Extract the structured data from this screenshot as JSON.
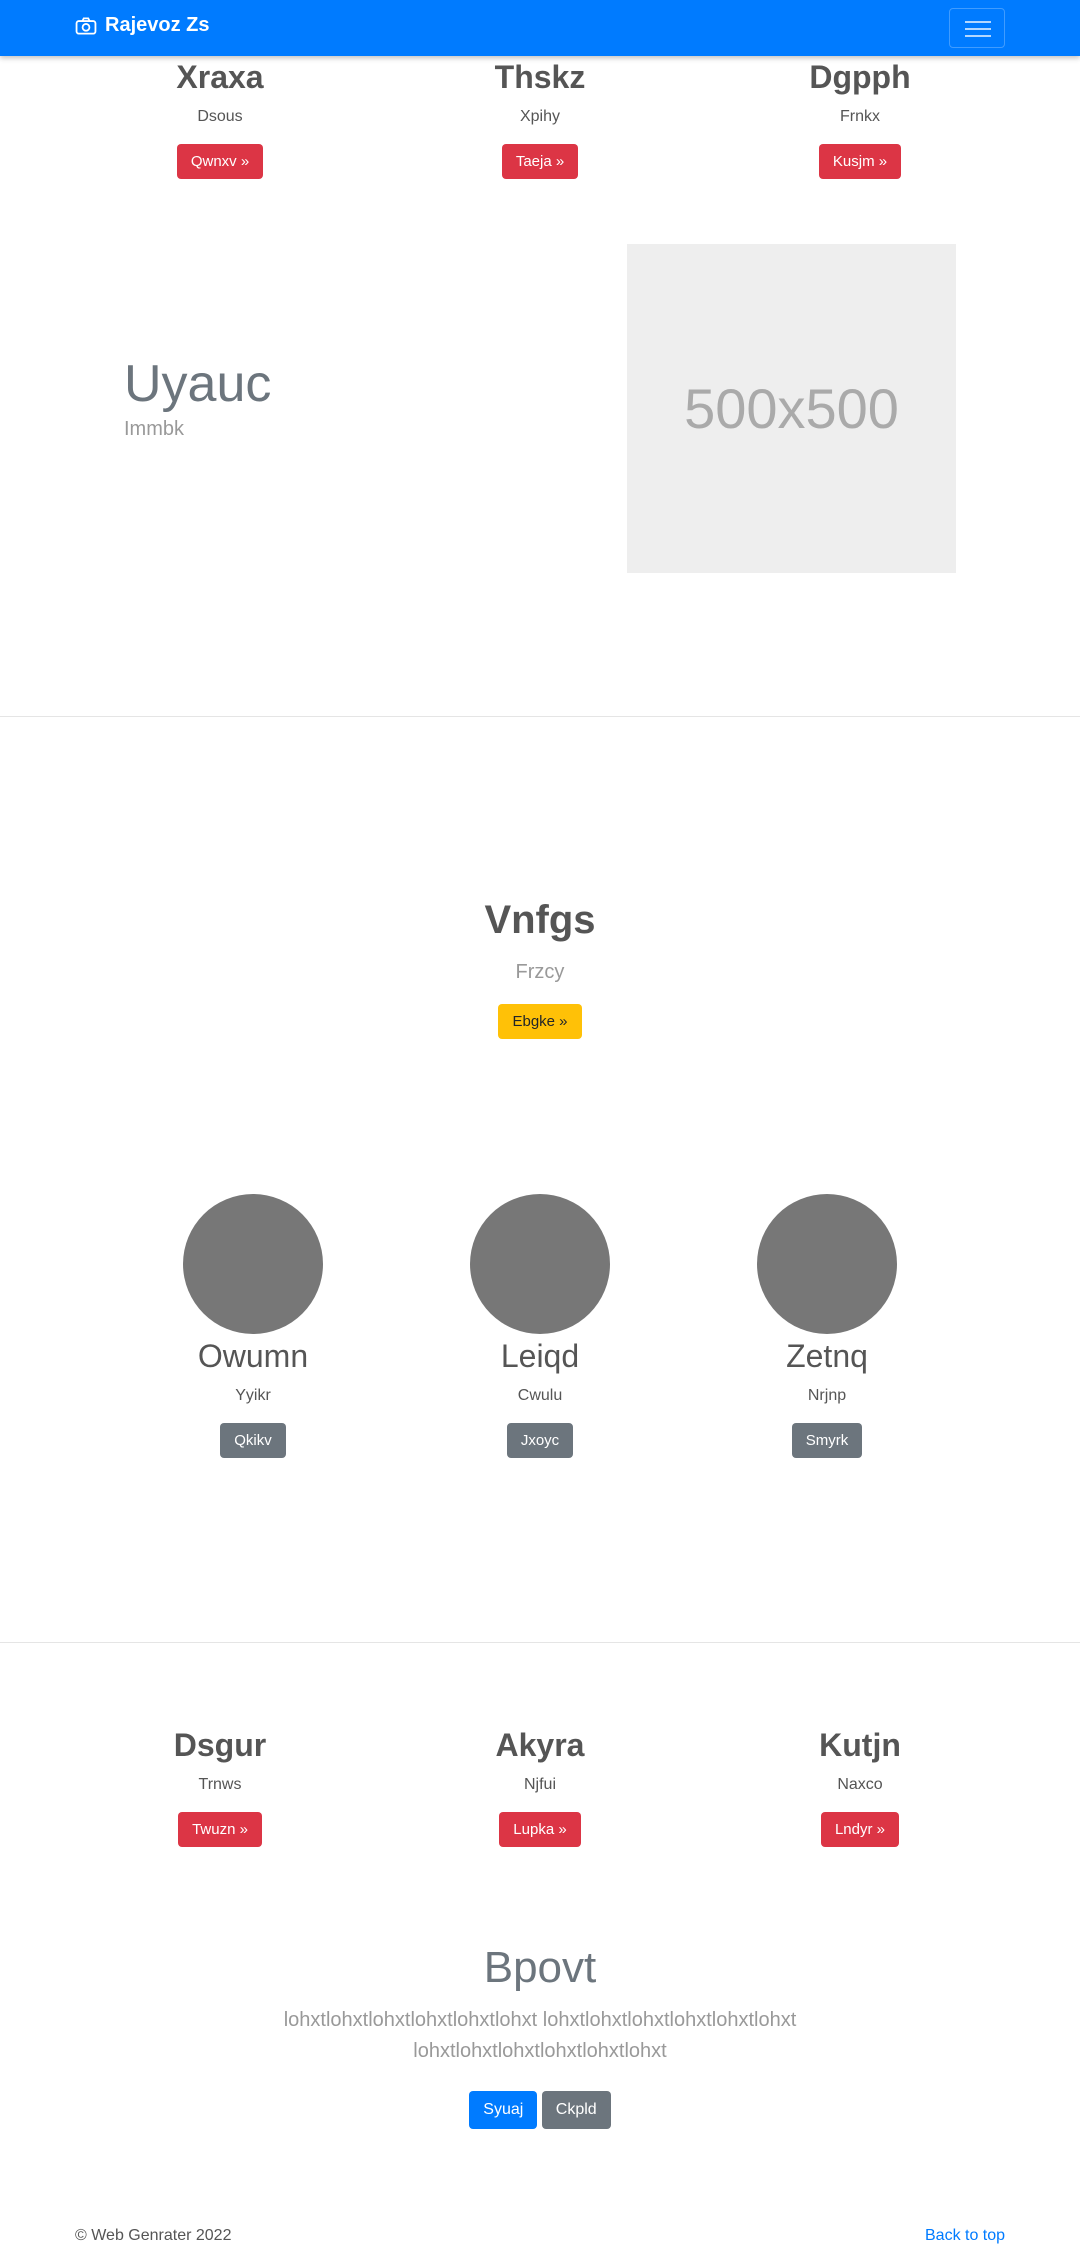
{
  "navbar": {
    "brand": "Rajevoz Zs",
    "brand_icon": "camera-icon",
    "menu_icon": "hamburger-menu-icon",
    "color": "#007bff"
  },
  "top_features": [
    {
      "title": "Xraxa",
      "subtitle": "Dsous",
      "button": "Qwnxv »"
    },
    {
      "title": "Thskz",
      "subtitle": "Xpihy",
      "button": "Taeja »"
    },
    {
      "title": "Dgpph",
      "subtitle": "Frnkx",
      "button": "Kusjm »"
    }
  ],
  "hero": {
    "title": "Uyauc",
    "subtitle": "Immbk",
    "image_label": "500x500"
  },
  "center_section": {
    "title": "Vnfgs",
    "subtitle": "Frzcy",
    "button": "Ebgke »"
  },
  "circle_features": [
    {
      "title": "Owumn",
      "subtitle": "Yyikr",
      "button": "Qkikv"
    },
    {
      "title": "Leiqd",
      "subtitle": "Cwulu",
      "button": "Jxoyc"
    },
    {
      "title": "Zetnq",
      "subtitle": "Nrjnp",
      "button": "Smyrk"
    }
  ],
  "bottom_features": [
    {
      "title": "Dsgur",
      "subtitle": "Trnws",
      "button": "Twuzn »"
    },
    {
      "title": "Akyra",
      "subtitle": "Njfui",
      "button": "Lupka »"
    },
    {
      "title": "Kutjn",
      "subtitle": "Naxco",
      "button": "Lndyr »"
    }
  ],
  "jumbotron": {
    "title": "Bpovt",
    "text_line1": "lohxtlohxtlohxtlohxtlohxtlohxt lohxtlohxtlohxtlohxtlohxtlohxt",
    "text_line2": "lohxtlohxtlohxtlohxtlohxtlohxt",
    "primary_button": "Syuaj",
    "secondary_button": "Ckpld"
  },
  "footer": {
    "copyright": "© Web Genrater 2022",
    "back_to_top": "Back to top"
  },
  "colors": {
    "primary": "#007bff",
    "danger": "#dc3545",
    "warning": "#ffc107",
    "secondary": "#6c757d",
    "placeholder_bg": "#eeeeee",
    "circle": "#777777"
  }
}
